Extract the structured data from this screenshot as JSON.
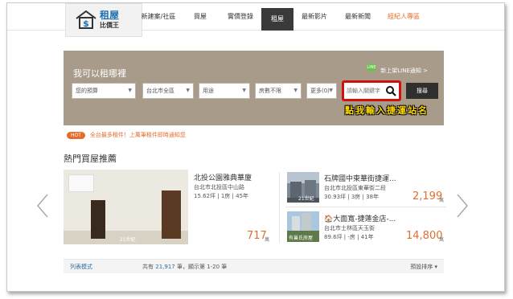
{
  "logo": {
    "line1": "租屋",
    "line2": "比價王"
  },
  "nav": {
    "items": [
      {
        "label": "新建案/社區"
      },
      {
        "label": "買屋"
      },
      {
        "label": "實價登錄"
      },
      {
        "label": "租屋",
        "active": true
      },
      {
        "label": "最新影片"
      },
      {
        "label": "最新新聞"
      },
      {
        "label": "經紀人專區"
      }
    ]
  },
  "search": {
    "title": "我可以租哪裡",
    "line_link": "新上架LINE通知 >",
    "line_badge": "LINE",
    "budget": "您的預算",
    "city": "台北市全區",
    "usage": "用途",
    "rooms": "房數不限",
    "more": "更多(0)",
    "keyword_placeholder": "請輸入關鍵字",
    "button": "搜尋",
    "hint": "點我輸入捷運站名"
  },
  "promo": {
    "tag": "HOT",
    "text": "全台最多租件！上萬筆租件即時通知您"
  },
  "section_title": "熱門買屋推薦",
  "featured": {
    "title": "北投公園雅典華廈",
    "address": "台北市北投區中山路",
    "spec": "15.62坪 | 1房 | 45年",
    "price": "717",
    "unit": "萬",
    "photo_tag": "21世紀"
  },
  "side_listings": [
    {
      "title": "石牌國中東華街捷運...",
      "address": "台北市北投區東華街二段",
      "spec": "30.93坪 | 3房 | 38年",
      "price": "2,199",
      "unit": "萬",
      "photo_tag": "21世紀"
    },
    {
      "title": "🏠大面寬-捷蓮金店-...",
      "address": "台北市士林區天玉街",
      "spec": "89.6坪 | -房 | 41年",
      "price": "14,800",
      "unit": "萬",
      "photo_tag": "有巢氏房屋"
    }
  ],
  "listbar": {
    "mode": "列表模式",
    "count_prefix": "共有",
    "count": "21,917",
    "count_suffix": "筆，顯示第 1-20 筆",
    "sort": "預設排序 ▾"
  },
  "colors": {
    "banner": "#a89b8a",
    "accent": "#e46d2e",
    "highlight": "#d10f0f",
    "hint": "#ffd800"
  }
}
